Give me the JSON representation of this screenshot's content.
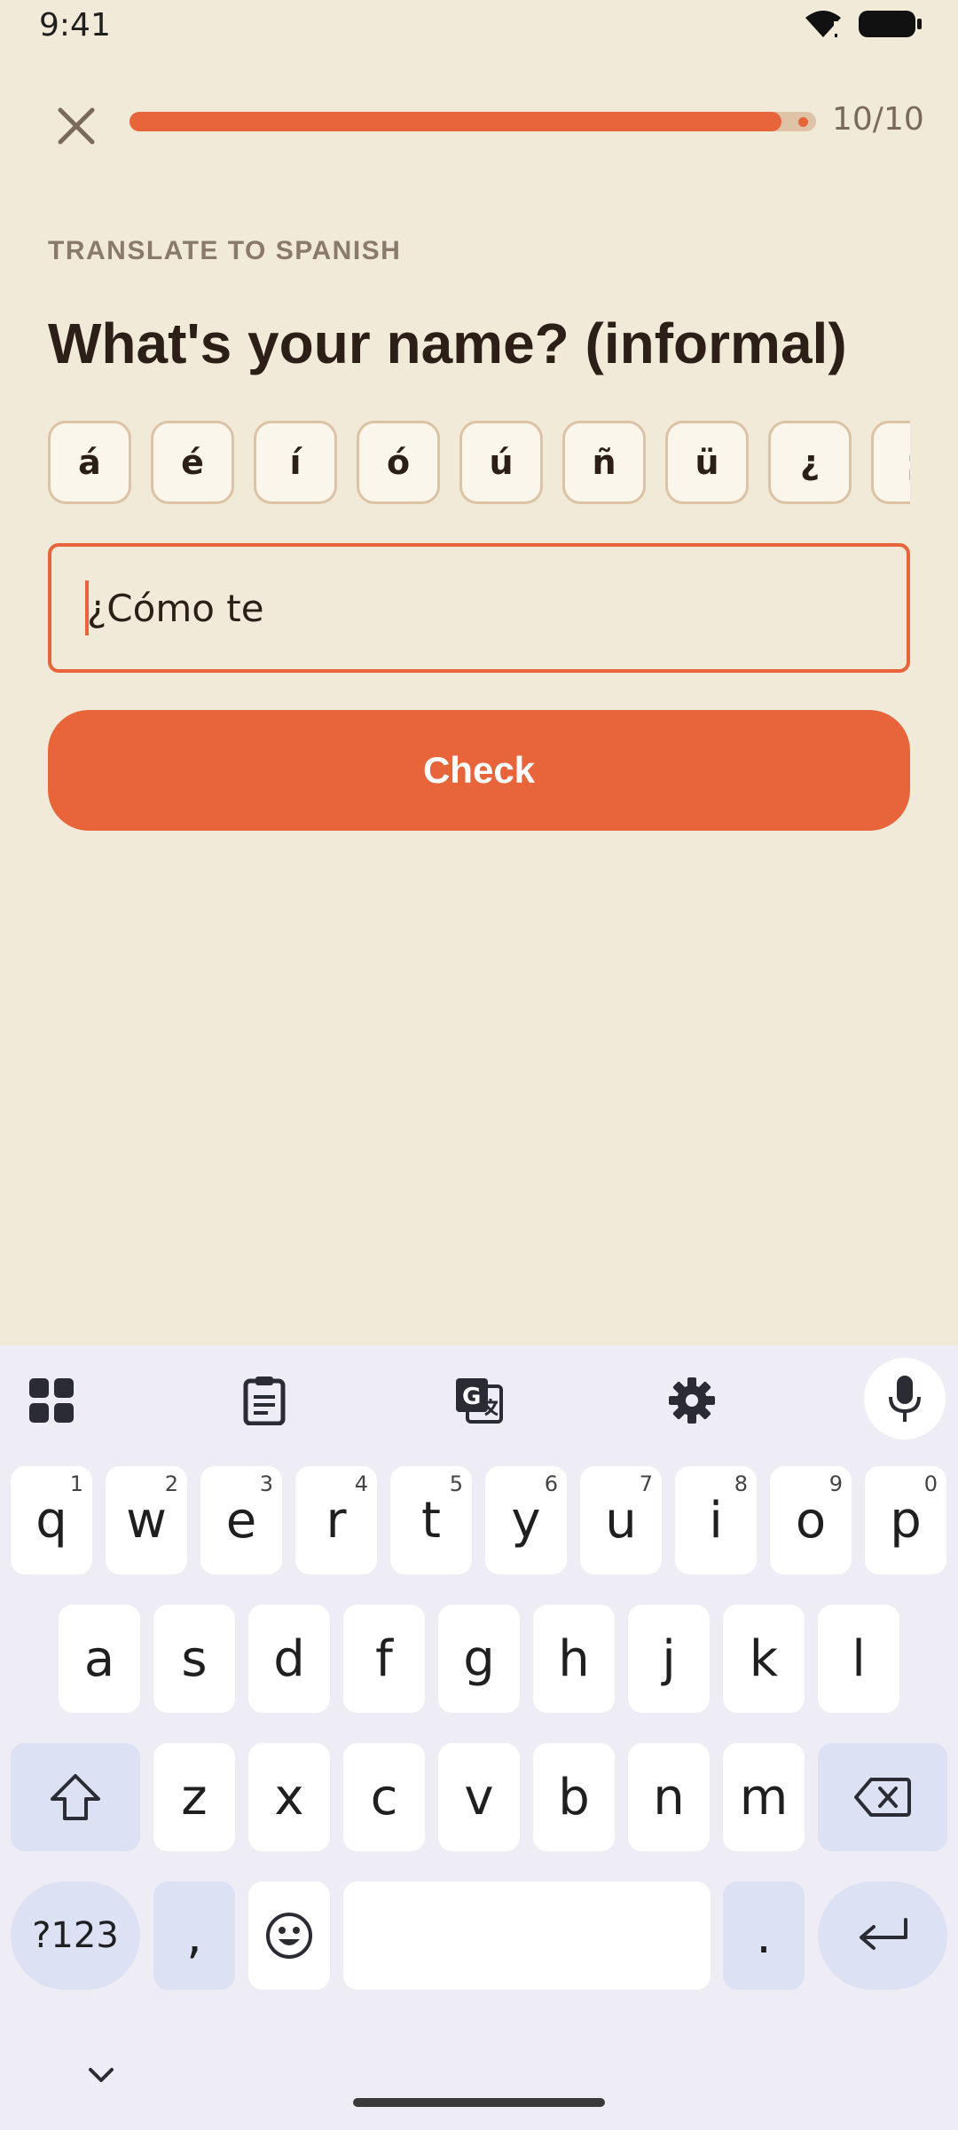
{
  "status_bar": {
    "time": "9:41"
  },
  "lesson": {
    "progress_label": "10/10",
    "progress_fraction": 0.95,
    "prompt_label": "TRANSLATE TO SPANISH",
    "prompt_text": "What's your name? (informal)",
    "accents": [
      "á",
      "é",
      "í",
      "ó",
      "ú",
      "ñ",
      "ü",
      "¿",
      "¡"
    ],
    "answer_value": "¿Cómo te",
    "check_label": "Check"
  },
  "keyboard": {
    "row1": [
      {
        "k": "q",
        "h": "1"
      },
      {
        "k": "w",
        "h": "2"
      },
      {
        "k": "e",
        "h": "3"
      },
      {
        "k": "r",
        "h": "4"
      },
      {
        "k": "t",
        "h": "5"
      },
      {
        "k": "y",
        "h": "6"
      },
      {
        "k": "u",
        "h": "7"
      },
      {
        "k": "i",
        "h": "8"
      },
      {
        "k": "o",
        "h": "9"
      },
      {
        "k": "p",
        "h": "0"
      }
    ],
    "row2": [
      "a",
      "s",
      "d",
      "f",
      "g",
      "h",
      "j",
      "k",
      "l"
    ],
    "row3": [
      "z",
      "x",
      "c",
      "v",
      "b",
      "n",
      "m"
    ],
    "symbols_label": "?123",
    "comma_label": ",",
    "period_label": "."
  },
  "icons": {
    "close": "close-icon",
    "apps": "apps-grid-icon",
    "clipboard": "clipboard-icon",
    "translate": "translate-icon",
    "settings": "gear-icon",
    "mic": "mic-icon",
    "shift": "shift-icon",
    "backspace": "backspace-icon",
    "emoji": "emoji-icon",
    "enter": "enter-icon",
    "collapse": "chevron-down-icon"
  },
  "colors": {
    "accent": "#E8643A",
    "background": "#F2EAD9",
    "keyboard_bg": "#EEEDF5"
  }
}
